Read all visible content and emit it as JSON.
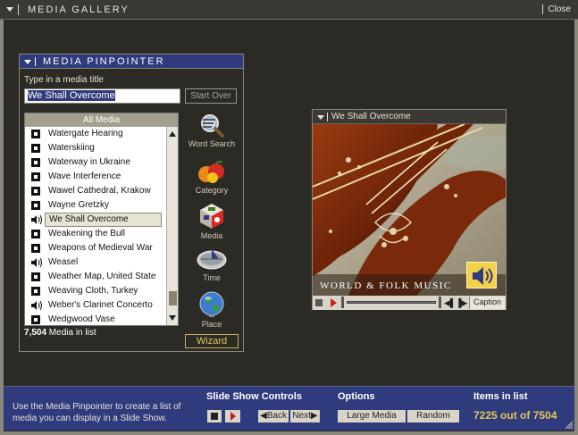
{
  "window": {
    "title": "MEDIA GALLERY",
    "close_label": "Close"
  },
  "pinpointer": {
    "title": "MEDIA PINPOINTER",
    "prompt": "Type in a media title",
    "search_value": "We Shall Overcome",
    "start_over_label": "Start Over",
    "list_header": "All Media",
    "items": [
      {
        "label": "Watergate Hearing",
        "icon": "film-icon"
      },
      {
        "label": "Waterskiing",
        "icon": "film-icon"
      },
      {
        "label": "Waterway in Ukraine",
        "icon": "film-icon"
      },
      {
        "label": "Wave Interference",
        "icon": "film-icon"
      },
      {
        "label": "Wawel Cathedral, Krakow",
        "icon": "film-icon"
      },
      {
        "label": "Wayne Gretzky",
        "icon": "film-icon"
      },
      {
        "label": "We Shall Overcome",
        "icon": "speaker-icon",
        "selected": true
      },
      {
        "label": "Weakening the Bull",
        "icon": "film-icon"
      },
      {
        "label": "Weapons of Medieval War",
        "icon": "film-icon"
      },
      {
        "label": "Weasel",
        "icon": "speaker-icon"
      },
      {
        "label": "Weather Map, United State",
        "icon": "film-icon"
      },
      {
        "label": "Weaving Cloth, Turkey",
        "icon": "film-icon"
      },
      {
        "label": "Weber's Clarinet Concerto",
        "icon": "speaker-icon"
      },
      {
        "label": "Wedgwood Vase",
        "icon": "film-icon"
      }
    ],
    "count_number": "7,504",
    "count_suffix": " Media in list",
    "wizard_label": "Wizard",
    "nav": [
      {
        "label": "Word Search",
        "icon": "magnifier-icon"
      },
      {
        "label": "Category",
        "icon": "fruit-icon"
      },
      {
        "label": "Media",
        "icon": "media-cube-icon"
      },
      {
        "label": "Time",
        "icon": "sundial-icon"
      },
      {
        "label": "Place",
        "icon": "globe-icon"
      }
    ]
  },
  "preview": {
    "title": "We Shall Overcome",
    "image_caption": "WORLD & FOLK MUSIC",
    "caption_button": "Caption",
    "playback_position": 0.0
  },
  "bottom": {
    "help_text": "Use the Media Pinpointer to create a list of media you can display in a Slide Show.",
    "slideshow_title": "Slide Show Controls",
    "back_label": "Back",
    "next_label": "Next",
    "options_title": "Options",
    "large_media_label": "Large Media",
    "random_label": "Random",
    "items_title": "Items in list",
    "items_value": "7225 out of 7504"
  },
  "colors": {
    "accent_blue": "#2f3b7c",
    "gold": "#e3c65a",
    "background": "#2b2a24"
  }
}
